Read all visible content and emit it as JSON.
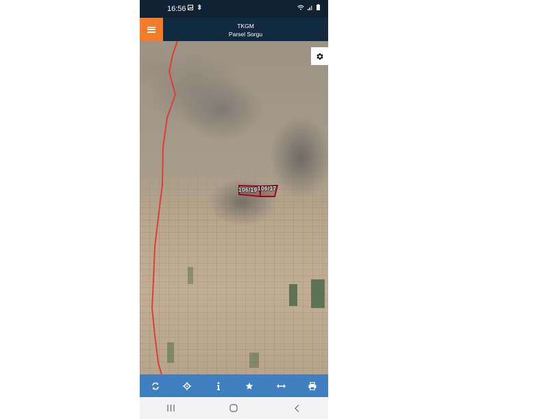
{
  "status_bar": {
    "time": "16:56",
    "left_icons": [
      "image-icon",
      "bluetooth-icon"
    ],
    "right_icons": [
      "wifi-icon",
      "signal-icon",
      "battery-icon"
    ]
  },
  "app_bar": {
    "menu_icon": "hamburger-icon",
    "title": "TKGM",
    "subtitle": "Parsel Sorgu",
    "accent_color": "#f47b2a",
    "background_color": "#112a3f"
  },
  "map": {
    "settings_icon": "gear-icon",
    "parcel_labels": [
      "106/19",
      "106/17"
    ],
    "boundary_color": "#e53935",
    "parcel_outline_color": "#8b1020"
  },
  "toolbar": {
    "background_color": "#3f7fc0",
    "buttons": [
      {
        "name": "refresh",
        "icon": "refresh-icon"
      },
      {
        "name": "locate",
        "icon": "crosshair-icon"
      },
      {
        "name": "info",
        "icon": "info-icon"
      },
      {
        "name": "favorite",
        "icon": "star-icon"
      },
      {
        "name": "measure",
        "icon": "measure-icon"
      },
      {
        "name": "print",
        "icon": "print-icon"
      }
    ]
  },
  "nav_bar": {
    "buttons": [
      "recent-apps-icon",
      "home-icon",
      "back-icon"
    ]
  }
}
